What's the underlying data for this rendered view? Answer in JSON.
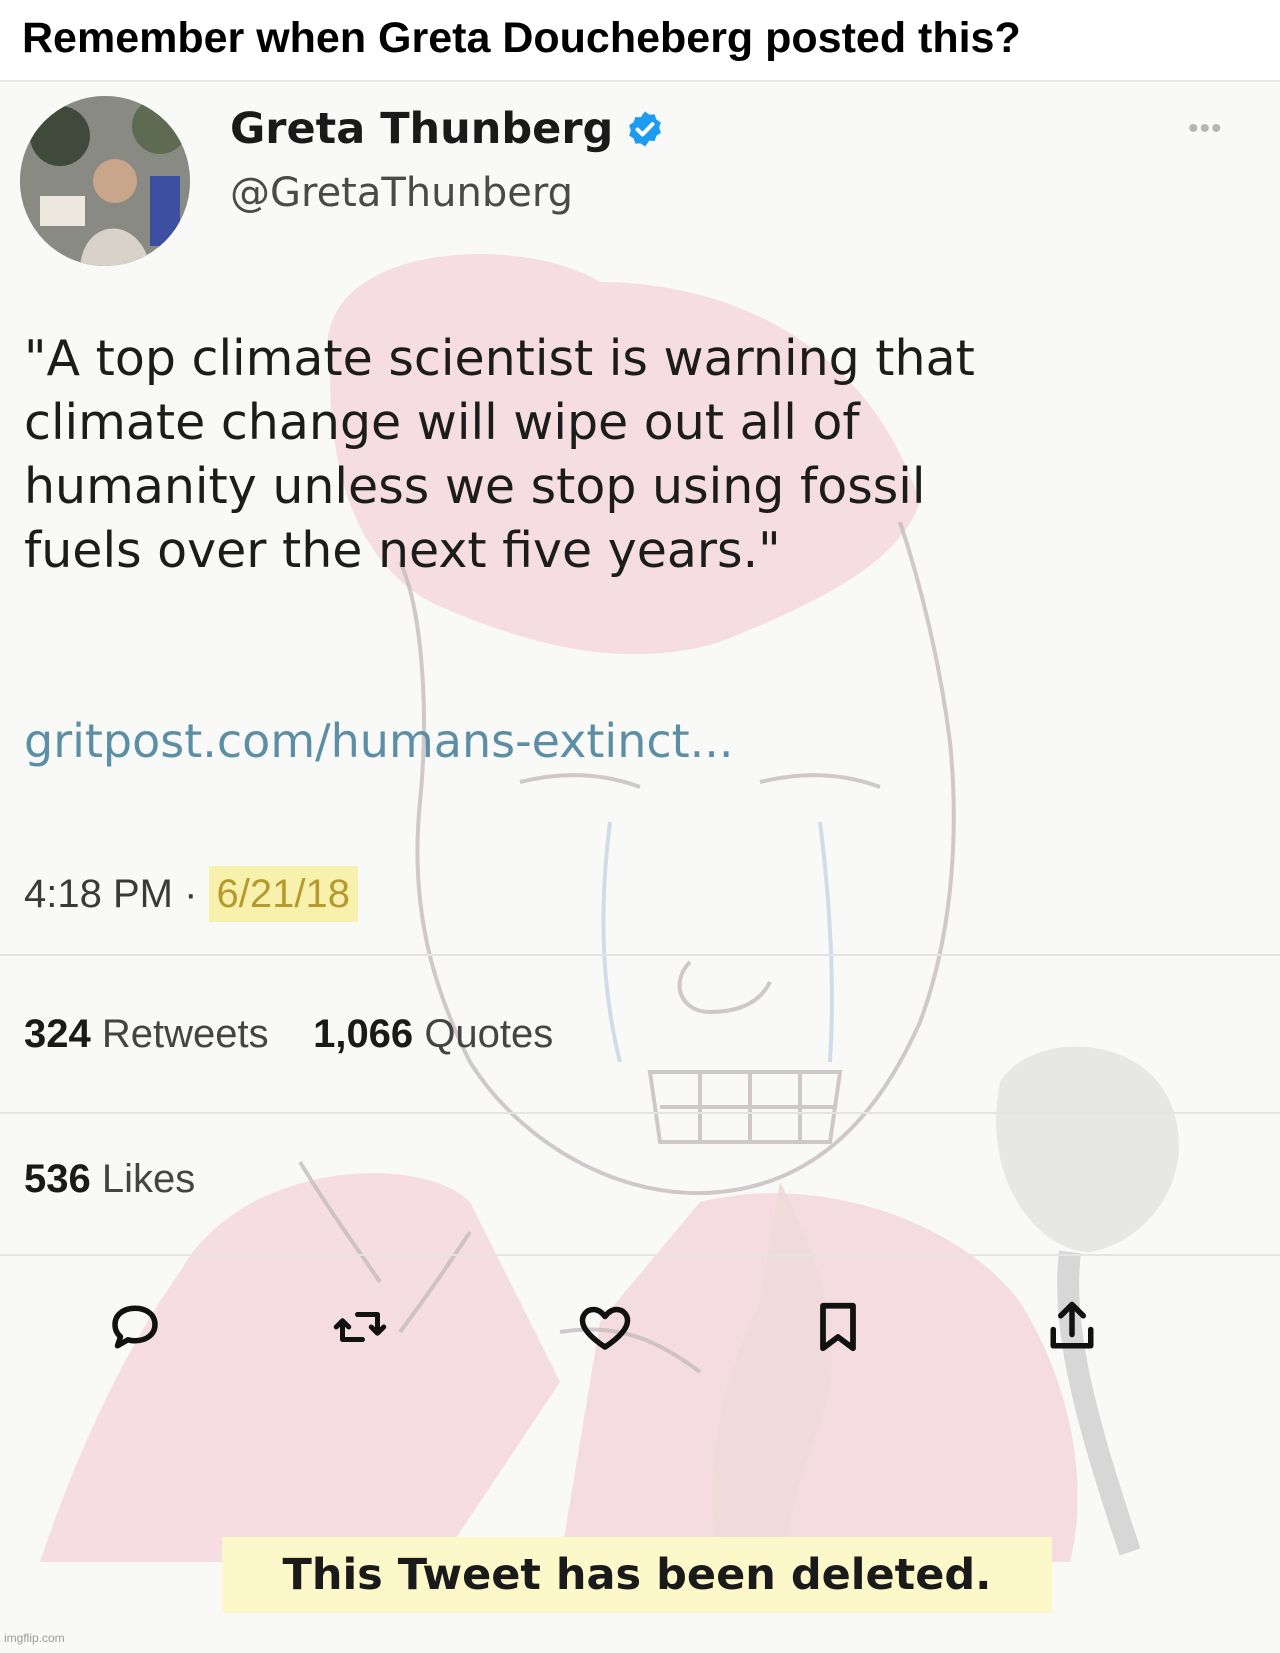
{
  "caption": "Remember when Greta Doucheberg posted this?",
  "tweet": {
    "display_name": "Greta Thunberg",
    "handle": "@GretaThunberg",
    "more_icon": "more-dots-icon",
    "text": "\"A top climate scientist is warning that\nclimate change will wipe out all of\nhumanity unless we stop using fossil\nfuels over the next five years.\"",
    "link": "gritpost.com/humans-extinct...",
    "time": "4:18 PM",
    "separator": " · ",
    "date": "6/21/18",
    "stats": {
      "retweets_count": "324",
      "retweets_label": "Retweets",
      "quotes_count": "1,066",
      "quotes_label": "Quotes",
      "likes_count": "536",
      "likes_label": "Likes"
    },
    "actions": [
      "reply-icon",
      "retweet-icon",
      "like-icon",
      "bookmark-icon",
      "share-icon"
    ],
    "deleted_notice": "This Tweet has been deleted."
  },
  "watermark": "imgflip.com",
  "colors": {
    "verified": "#1d9bf0",
    "link": "#5c8fa6",
    "highlight": "#f8f1ad",
    "wojak_fill": "#f3c6d0",
    "wojak_line": "#c4bcc0"
  }
}
